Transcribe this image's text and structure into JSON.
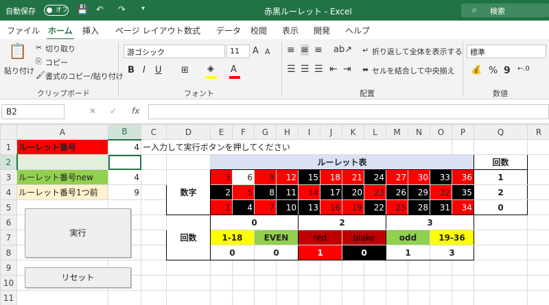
{
  "title_bar": {
    "auto_save_label": "自動保存",
    "auto_save_state": "オフ",
    "doc_title": "赤黒ルーレット - Excel",
    "search_label": "検索"
  },
  "ribbon_tabs": [
    "ファイル",
    "ホーム",
    "挿入",
    "ページ レイアウト",
    "数式",
    "データ",
    "校閲",
    "表示",
    "開発",
    "ヘルプ"
  ],
  "ribbon": {
    "paste_label": "貼り付け",
    "cut_label": "切り取り",
    "copy_label": "コピー",
    "format_painter_label": "書式のコピー/貼り付け",
    "clipboard_group": "クリップボード",
    "font_name": "游ゴシック",
    "font_size": "11",
    "font_group": "フォント",
    "wrap_text_label": "折り返して全体を表示する",
    "merge_center_label": "セルを結合して中央揃え",
    "alignment_group": "配置",
    "number_format": "標準",
    "number_group": "数値",
    "bold_label": "B",
    "italic_label": "I",
    "underline_label": "U",
    "grow_font": "A",
    "shrink_font": "A",
    "font_color_label": "A",
    "percent_label": "%",
    "comma_label": "9"
  },
  "formula_bar": {
    "name_box": "B2",
    "formula": ""
  },
  "columns": [
    "A",
    "B",
    "C",
    "D",
    "E",
    "F",
    "G",
    "H",
    "I",
    "J",
    "K",
    "L",
    "M",
    "N",
    "O",
    "P",
    "Q",
    "R"
  ],
  "rows": [
    "1",
    "2",
    "3",
    "4",
    "5",
    "6",
    "7",
    "8",
    "9",
    "10",
    "11"
  ],
  "cells": {
    "a1": "ルーレット番号",
    "b1": "4",
    "c1": "ー入力して実行ボタンを押してください",
    "a3": "ルーレット番号new",
    "b3": "4",
    "a4": "ルーレット番号1つ前",
    "b4": "9"
  },
  "roulette": {
    "title": "ルーレット表",
    "count_header": "回数",
    "number_label": "数字",
    "count_label": "回数",
    "number_rows": [
      [
        "3",
        "6",
        "9",
        "12",
        "15",
        "18",
        "21",
        "24",
        "27",
        "30",
        "33",
        "36"
      ],
      [
        "2",
        "5",
        "8",
        "11",
        "14",
        "17",
        "20",
        "23",
        "26",
        "29",
        "32",
        "35"
      ],
      [
        "1",
        "4",
        "7",
        "10",
        "13",
        "16",
        "19",
        "22",
        "25",
        "28",
        "31",
        "34"
      ]
    ],
    "row_counts": [
      "1",
      "2",
      "0"
    ],
    "dozen_counts": [
      "0",
      "2",
      "3"
    ],
    "bet_labels": [
      "1-18",
      "EVEN",
      "red",
      "blake",
      "odd",
      "19-36"
    ],
    "bet_counts": [
      "0",
      "0",
      "1",
      "0",
      "1",
      "3"
    ]
  },
  "buttons": {
    "run_label": "実行",
    "reset_label": "リセット"
  },
  "colors": {
    "excel_green": "#217346",
    "red": "#ff0000",
    "black": "#000000",
    "yellow": "#ffff00",
    "green": "#92d050",
    "crimson": "#c00000"
  }
}
